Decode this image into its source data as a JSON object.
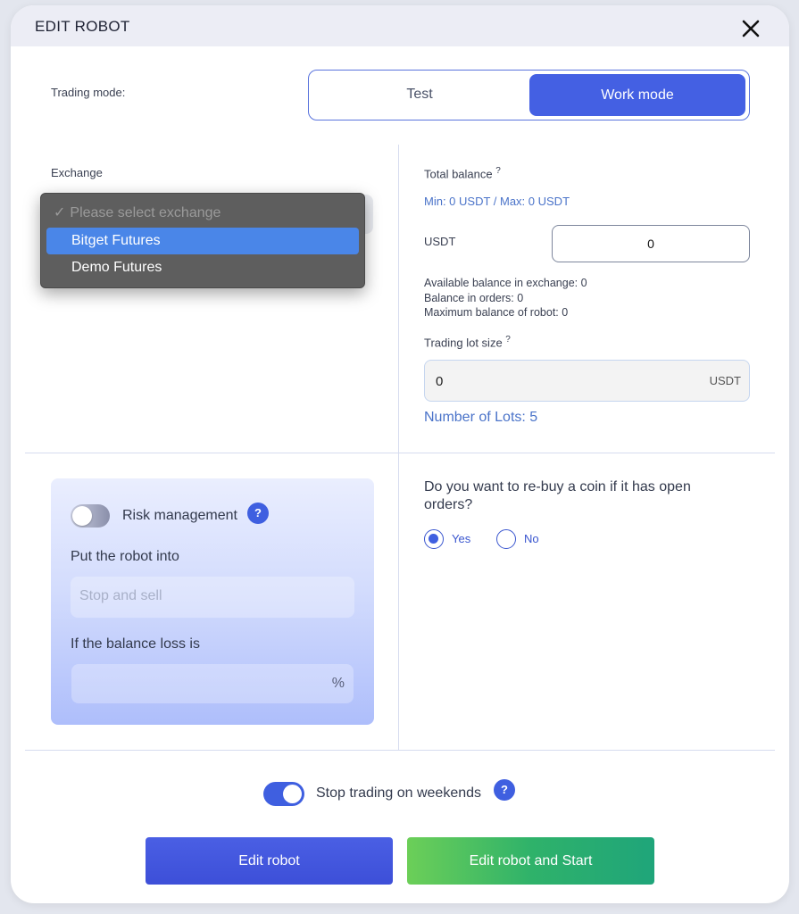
{
  "modal": {
    "title": "EDIT ROBOT"
  },
  "trading_mode": {
    "label": "Trading mode:",
    "options": [
      "Test",
      "Work mode"
    ],
    "selected": "Work mode"
  },
  "exchange": {
    "label": "Exchange",
    "dropdown": {
      "placeholder": "Please select exchange",
      "options": [
        "Bitget Futures",
        "Demo Futures"
      ],
      "highlighted": "Bitget Futures"
    }
  },
  "balance": {
    "total_label": "Total balance",
    "help_mark": "?",
    "min_max": "Min: 0 USDT / Max: 0 USDT",
    "currency_label": "USDT",
    "value": "0",
    "available": "Available balance in exchange: 0",
    "in_orders": "Balance in orders: 0",
    "max_robot": "Maximum balance of robot: 0"
  },
  "lot": {
    "label": "Trading lot size",
    "help_mark": "?",
    "value": "0",
    "unit": "USDT",
    "number_of_lots": "Number of Lots: 5"
  },
  "risk": {
    "toggle_label": "Risk management",
    "enabled": false,
    "put_label": "Put the robot into",
    "put_placeholder": "Stop and sell",
    "loss_label": "If the balance loss is",
    "loss_unit": "%"
  },
  "rebuy": {
    "question": "Do you want to re-buy a coin if it has open orders?",
    "yes": "Yes",
    "no": "No",
    "selected": "Yes"
  },
  "weekends": {
    "label": "Stop trading on weekends",
    "enabled": true
  },
  "buttons": {
    "edit": "Edit robot",
    "edit_start": "Edit robot and Start"
  },
  "colors": {
    "accent": "#3f5fe0",
    "link_blue": "#4a73c9",
    "green_start": "#6ccf58",
    "green_end": "#1fa57a"
  },
  "icons": {
    "close": "close-icon",
    "help": "question-icon",
    "check": "checkmark-icon"
  }
}
